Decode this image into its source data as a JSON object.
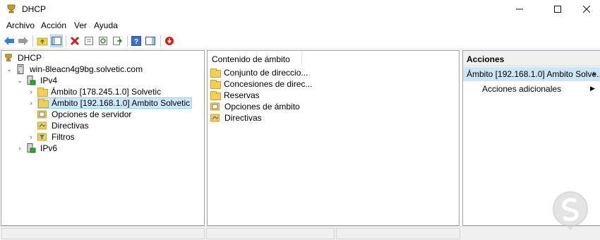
{
  "window": {
    "title": "DHCP"
  },
  "menu": [
    "Archivo",
    "Acción",
    "Ver",
    "Ayuda"
  ],
  "tree": {
    "root": "DHCP",
    "server": "win-8leacn4g9bg.solvetic.com",
    "ipv4": "IPv4",
    "scope1": "Ámbito [178.245.1.0] Solvetic",
    "scope2": "Ámbito [192.168.1.0] Ambito Solvetic",
    "server_options": "Opciones de servidor",
    "policies": "Directivas",
    "filters": "Filtros",
    "ipv6": "IPv6"
  },
  "middle": {
    "column_header": "Contenido de ámbito",
    "items": [
      "Conjunto de direccio...",
      "Concesiones de direc...",
      "Reservas",
      "Opciones de ámbito",
      "Directivas"
    ]
  },
  "actions": {
    "header": "Acciones",
    "group": "Ámbito [192.168.1.0] Ambito Solve...",
    "item": "Acciones adicionales"
  },
  "colors": {
    "selection": "#cce8ff",
    "actions_group": "#cde6f7",
    "folder": "#f4cf58"
  }
}
